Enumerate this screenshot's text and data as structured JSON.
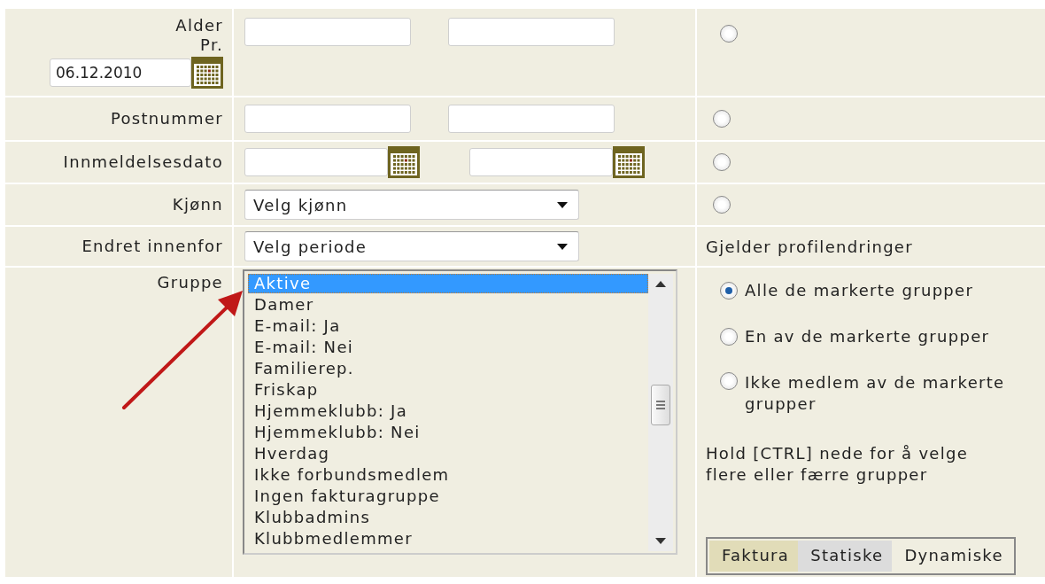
{
  "filters": [
    {
      "kind": "range",
      "label": "Alder",
      "sublabel": "Pr.",
      "date_value": "06.12.2010",
      "selected": false
    },
    {
      "kind": "range",
      "label": "Postnummer",
      "selected": false
    },
    {
      "kind": "date_range",
      "label": "Innmeldelsesdato",
      "selected": false
    },
    {
      "kind": "select",
      "label": "Kjønn",
      "value": "Velg kjønn",
      "selected": false
    },
    {
      "kind": "select",
      "label": "Endret innenfor",
      "value": "Velg periode",
      "note": "Gjelder profilendringer"
    }
  ],
  "group": {
    "label": "Gruppe",
    "items": [
      {
        "text": "Aktive",
        "selected": true
      },
      {
        "text": "Damer",
        "selected": false
      },
      {
        "text": "E-mail: Ja",
        "selected": false
      },
      {
        "text": "E-mail: Nei",
        "selected": false
      },
      {
        "text": "Familierep.",
        "selected": false
      },
      {
        "text": "Friskap",
        "selected": false
      },
      {
        "text": "Hjemmeklubb: Ja",
        "selected": false
      },
      {
        "text": "Hjemmeklubb: Nei",
        "selected": false
      },
      {
        "text": "Hverdag",
        "selected": false
      },
      {
        "text": "Ikke forbundsmedlem",
        "selected": false
      },
      {
        "text": "Ingen fakturagruppe",
        "selected": false
      },
      {
        "text": "Klubbadmins",
        "selected": false
      },
      {
        "text": "Klubbmedlemmer",
        "selected": false
      }
    ],
    "options": [
      {
        "label": "Alle de markerte grupper",
        "selected": true
      },
      {
        "label": "En av de markerte grupper",
        "selected": false
      },
      {
        "label": "Ikke medlem av de markerte grupper",
        "selected": false
      }
    ],
    "hint": "Hold [CTRL] nede for å velge flere eller færre grupper",
    "tabs": [
      {
        "label": "Faktura",
        "selected": true,
        "highlighted": false
      },
      {
        "label": "Statiske",
        "selected": false,
        "highlighted": true
      },
      {
        "label": "Dynamiske",
        "selected": false,
        "highlighted": false
      }
    ]
  }
}
